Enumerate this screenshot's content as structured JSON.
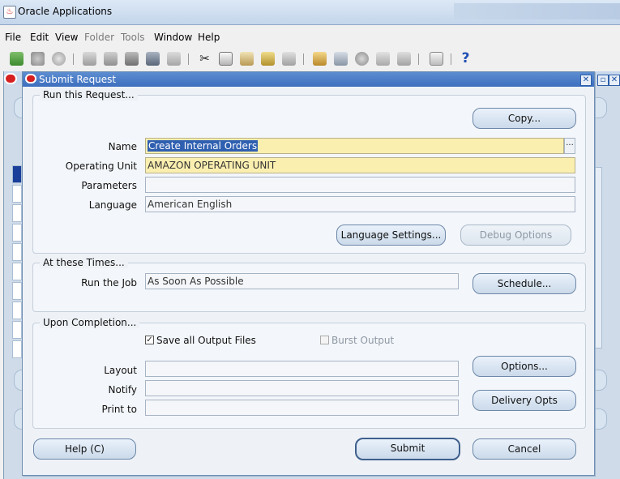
{
  "window": {
    "title": "Oracle Applications"
  },
  "menu": [
    {
      "label": "File",
      "disabled": false
    },
    {
      "label": "Edit",
      "disabled": false
    },
    {
      "label": "View",
      "disabled": false
    },
    {
      "label": "Folder",
      "disabled": true
    },
    {
      "label": "Tools",
      "disabled": true
    },
    {
      "label": "Window",
      "disabled": false
    },
    {
      "label": "Help",
      "disabled": false
    }
  ],
  "toolbar": {
    "help_glyph": "?"
  },
  "dialog": {
    "title": "Submit Request",
    "close_glyph": "✕",
    "run_group": {
      "label": "Run this Request...",
      "copy_button": "Copy...",
      "name_label": "Name",
      "name_value": "Create Internal Orders",
      "operating_unit_label": "Operating Unit",
      "operating_unit_value": "AMAZON OPERATING UNIT",
      "parameters_label": "Parameters",
      "parameters_value": "",
      "language_label": "Language",
      "language_value": "American English",
      "language_settings_button": "Language Settings...",
      "debug_options_button": "Debug Options",
      "lov_glyph": "..."
    },
    "times_group": {
      "label": "At these Times...",
      "run_job_label": "Run the Job",
      "run_job_value": "As Soon As Possible",
      "schedule_button": "Schedule..."
    },
    "completion_group": {
      "label": "Upon Completion...",
      "save_output_label": "Save all Output Files",
      "save_output_checked": true,
      "burst_output_label": "Burst Output",
      "burst_output_checked": false,
      "layout_label": "Layout",
      "layout_value": "",
      "notify_label": "Notify",
      "notify_value": "",
      "print_to_label": "Print to",
      "print_to_value": "",
      "options_button": "Options...",
      "delivery_opts_button": "Delivery Opts"
    },
    "help_button": "Help (C)",
    "submit_button": "Submit",
    "cancel_button": "Cancel"
  }
}
